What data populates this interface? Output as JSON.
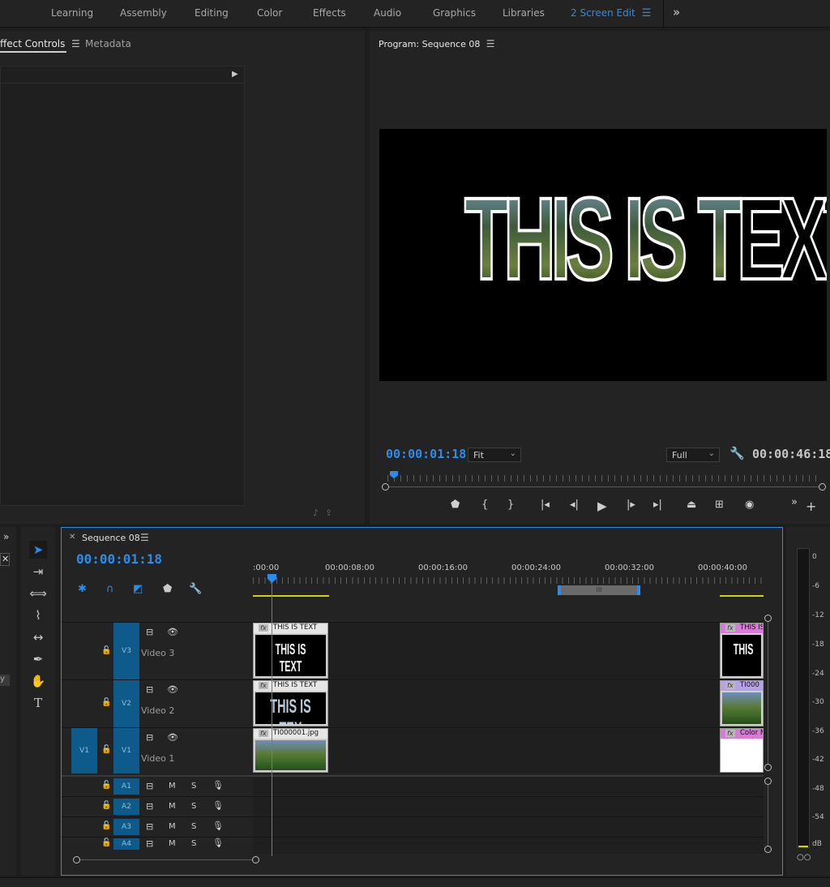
{
  "workspaces": {
    "tabs": [
      "Learning",
      "Assembly",
      "Editing",
      "Color",
      "Effects",
      "Audio",
      "Graphics",
      "Libraries"
    ],
    "active": "2 Screen Edit",
    "more_icon": "double-chevron-right-icon"
  },
  "left_panel": {
    "tabs": [
      "ffect Controls",
      "Metadata"
    ]
  },
  "program_monitor": {
    "title": "Program: Sequence 08",
    "frame_text": "THIS IS TEXT",
    "current_timecode": "00:00:01:18",
    "duration": "00:00:46:18",
    "zoom": "Fit",
    "resolution": "Full",
    "transport_icons": [
      "marker-icon",
      "mark-in-icon",
      "mark-out-icon",
      "go-to-in-icon",
      "step-back-icon",
      "play-icon",
      "step-forward-icon",
      "go-to-out-icon",
      "lift-icon",
      "extract-icon",
      "export-frame-icon"
    ]
  },
  "timeline": {
    "sequence_name": "Sequence 08",
    "timecode": "00:00:01:18",
    "ruler_labels": [
      ":00:00",
      "00:00:08:00",
      "00:00:16:00",
      "00:00:24:00",
      "00:00:32:00",
      "00:00:40:00"
    ],
    "video_tracks": [
      {
        "id": "V3",
        "name": "Video 3"
      },
      {
        "id": "V2",
        "name": "Video 2"
      },
      {
        "id": "V1",
        "name": "Video 1",
        "source": "V1"
      }
    ],
    "audio_tracks": [
      {
        "id": "A1",
        "m": "M",
        "s": "S"
      },
      {
        "id": "A2",
        "m": "M",
        "s": "S"
      },
      {
        "id": "A3",
        "m": "M",
        "s": "S"
      },
      {
        "id": "A4",
        "m": "M",
        "s": "S"
      }
    ],
    "clips": {
      "v3_a": "THIS IS TEXT",
      "v3_a_thumb": "THIS IS TEXT",
      "v2_a": "THIS IS TEXT",
      "v2_a_thumb": "THIS IS TEX",
      "v1_a": "TI000001.jpg",
      "v3_b": "THIS IS",
      "v3_b_thumb": "THIS",
      "v2_b": "TI000",
      "v1_b": "Color M"
    },
    "fx_label": "fx",
    "zoom_handle": "III"
  },
  "meters": {
    "labels": [
      "0",
      "-6",
      "-12",
      "-18",
      "-24",
      "-30",
      "-36",
      "-42",
      "-48",
      "-54",
      "dB"
    ],
    "solo_buttons": "○○"
  },
  "colors": {
    "accent": "#2d8ceb",
    "work_area": "#d4d400",
    "clip_pink": "#d67bd6",
    "clip_violet": "#b6a3e6",
    "track_patch": "#0e5a8a"
  }
}
